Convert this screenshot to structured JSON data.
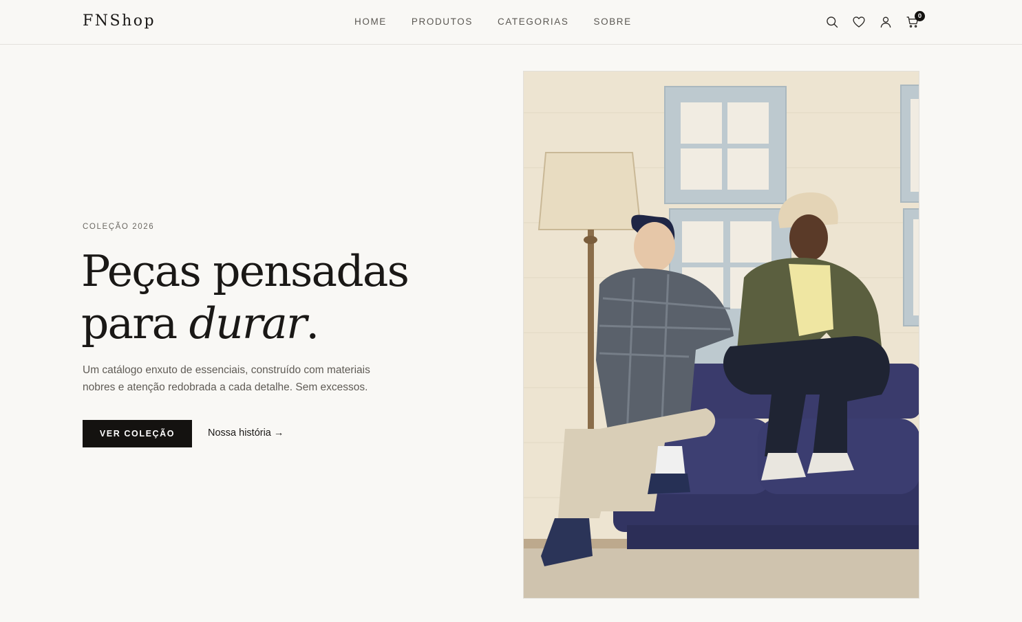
{
  "brand": {
    "logo": "FNShop"
  },
  "nav": {
    "items": [
      {
        "label": "HOME"
      },
      {
        "label": "PRODUTOS"
      },
      {
        "label": "CATEGORIAS"
      },
      {
        "label": "SOBRE"
      }
    ]
  },
  "header_icons": {
    "search": "search-icon",
    "wishlist": "heart-icon",
    "account": "user-icon",
    "cart": "cart-icon",
    "cart_count": "0"
  },
  "hero": {
    "eyebrow": "COLEÇÃO 2026",
    "headline_line1": "Peças pensadas",
    "headline_line2_prefix": "para ",
    "headline_line2_emphasis": "durar",
    "headline_line2_suffix": ".",
    "description": "Um catálogo enxuto de essenciais, construído com materiais nobres e atenção redobrada a cada detalhe. Sem excessos.",
    "cta_primary": "VER COLEÇÃO",
    "cta_secondary": "Nossa história →"
  },
  "colors": {
    "background": "#f9f8f5",
    "text": "#1a1816",
    "muted": "#5f5b55",
    "button": "#141210"
  }
}
